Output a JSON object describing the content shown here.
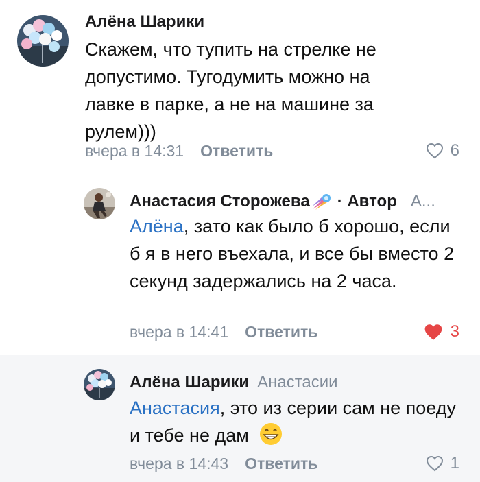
{
  "comments": [
    {
      "author": "Алёна Шарики",
      "text": "Скажем, что тупить на стрелке не допустимо. Тугодумить можно на лавке в парке, а не на машине за рулем)))",
      "time": "вчера в 14:31",
      "reply_label": "Ответить",
      "likes": "6",
      "liked": false
    },
    {
      "author": "Анастасия Сторожева",
      "role": "· Автор",
      "truncated": "А...",
      "mention": "Алёна",
      "text": ", зато как было б хорошо, если б я в него въехала, и все бы вместо 2 секунд задержались на 2 часа.",
      "time": "вчера в 14:41",
      "reply_label": "Ответить",
      "likes": "3",
      "liked": true
    },
    {
      "author": "Алёна Шарики",
      "reply_to": "Анастасии",
      "mention": "Анастасия",
      "text": ", это из серии сам не поеду и тебе не дам",
      "time": "вчера в 14:43",
      "reply_label": "Ответить",
      "likes": "1",
      "liked": false
    }
  ],
  "colors": {
    "link": "#2a71c4",
    "secondary": "#818c99",
    "like_active": "#e64646",
    "highlight_bg": "#f5f6f8"
  },
  "icons": [
    "balloons-avatar",
    "user-photo-avatar",
    "comet-emoji",
    "heart-icon",
    "grinning-emoji"
  ]
}
